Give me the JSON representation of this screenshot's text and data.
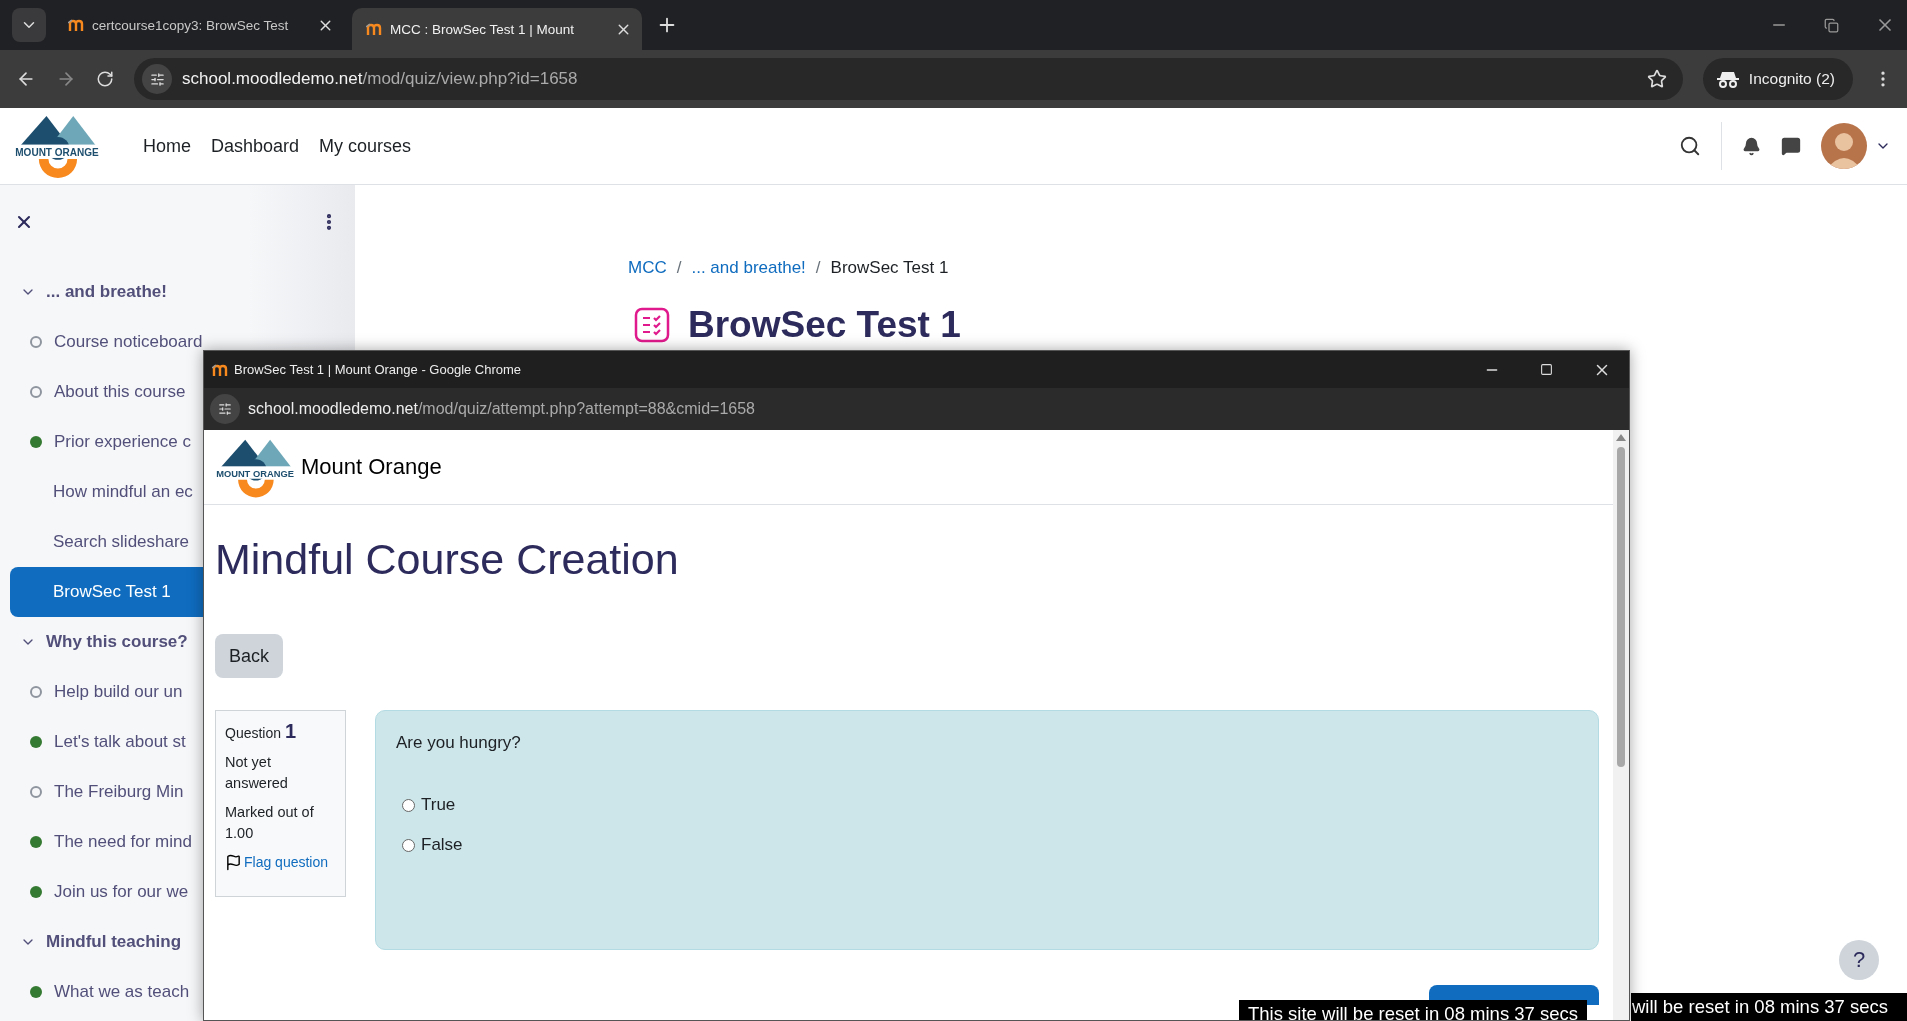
{
  "browser": {
    "tabs": [
      {
        "title": "certcourse1copy3: BrowSec Test",
        "selected": false
      },
      {
        "title": "MCC : BrowSec Test 1 | Mount",
        "selected": true
      }
    ],
    "url_host": "school.moodledemo.net",
    "url_path": "/mod/quiz/view.php?id=1658",
    "profile": "Incognito (2)"
  },
  "header": {
    "logo_text": "MOUNT ORANGE",
    "nav": [
      "Home",
      "Dashboard",
      "My courses"
    ]
  },
  "sidebar": {
    "sections": [
      {
        "title": "... and breathe!",
        "expanded": true,
        "items": [
          {
            "label": "Course noticeboard",
            "kind": "todo",
            "selected": false
          },
          {
            "label": "About this course",
            "kind": "todo",
            "selected": false
          },
          {
            "label": "Prior experience c",
            "kind": "done",
            "selected": false
          },
          {
            "label": "How mindful an ec",
            "kind": "plain",
            "selected": false
          },
          {
            "label": "Search slideshare",
            "kind": "plain",
            "selected": false
          },
          {
            "label": "BrowSec Test 1",
            "kind": "plain",
            "selected": true
          }
        ]
      },
      {
        "title": "Why this course?",
        "expanded": true,
        "items": [
          {
            "label": "Help build our un",
            "kind": "todo",
            "selected": false
          },
          {
            "label": "Let's talk about st",
            "kind": "done",
            "selected": false
          },
          {
            "label": "The Freiburg Min",
            "kind": "todo",
            "selected": false
          },
          {
            "label": "The need for mind",
            "kind": "done",
            "selected": false
          },
          {
            "label": "Join us for our we",
            "kind": "done",
            "selected": false
          }
        ]
      },
      {
        "title": "Mindful teaching",
        "expanded": true,
        "items": [
          {
            "label": "What we as teach",
            "kind": "done",
            "selected": false
          }
        ]
      }
    ]
  },
  "breadcrumb": {
    "items": [
      {
        "label": "MCC",
        "link": true
      },
      {
        "label": "... and breathe!",
        "link": true
      },
      {
        "label": "BrowSec Test 1",
        "link": false
      }
    ],
    "separators": [
      "/",
      "/"
    ]
  },
  "page_title": "BrowSec Test 1",
  "popup": {
    "title": "BrowSec Test 1 | Mount Orange - Google Chrome",
    "url_host": "school.moodledemo.net",
    "url_path": "/mod/quiz/attempt.php?attempt=88&cmid=1658",
    "logo_text": "MOUNT ORANGE",
    "site_name": "Mount Orange",
    "heading": "Mindful Course Creation",
    "back": "Back",
    "question": {
      "label": "Question",
      "number": "1",
      "state": "Not yet answered",
      "marks": "Marked out of 1.00",
      "flag": "Flag question",
      "text": "Are you hungry?",
      "options": [
        {
          "label": "True",
          "selected": false
        },
        {
          "label": "False",
          "selected": false
        }
      ]
    },
    "reset_notice": "This site will be reset in 08 mins 37 secs"
  },
  "reset_notice": "will be reset in 08 mins 37 secs",
  "help": "?"
}
